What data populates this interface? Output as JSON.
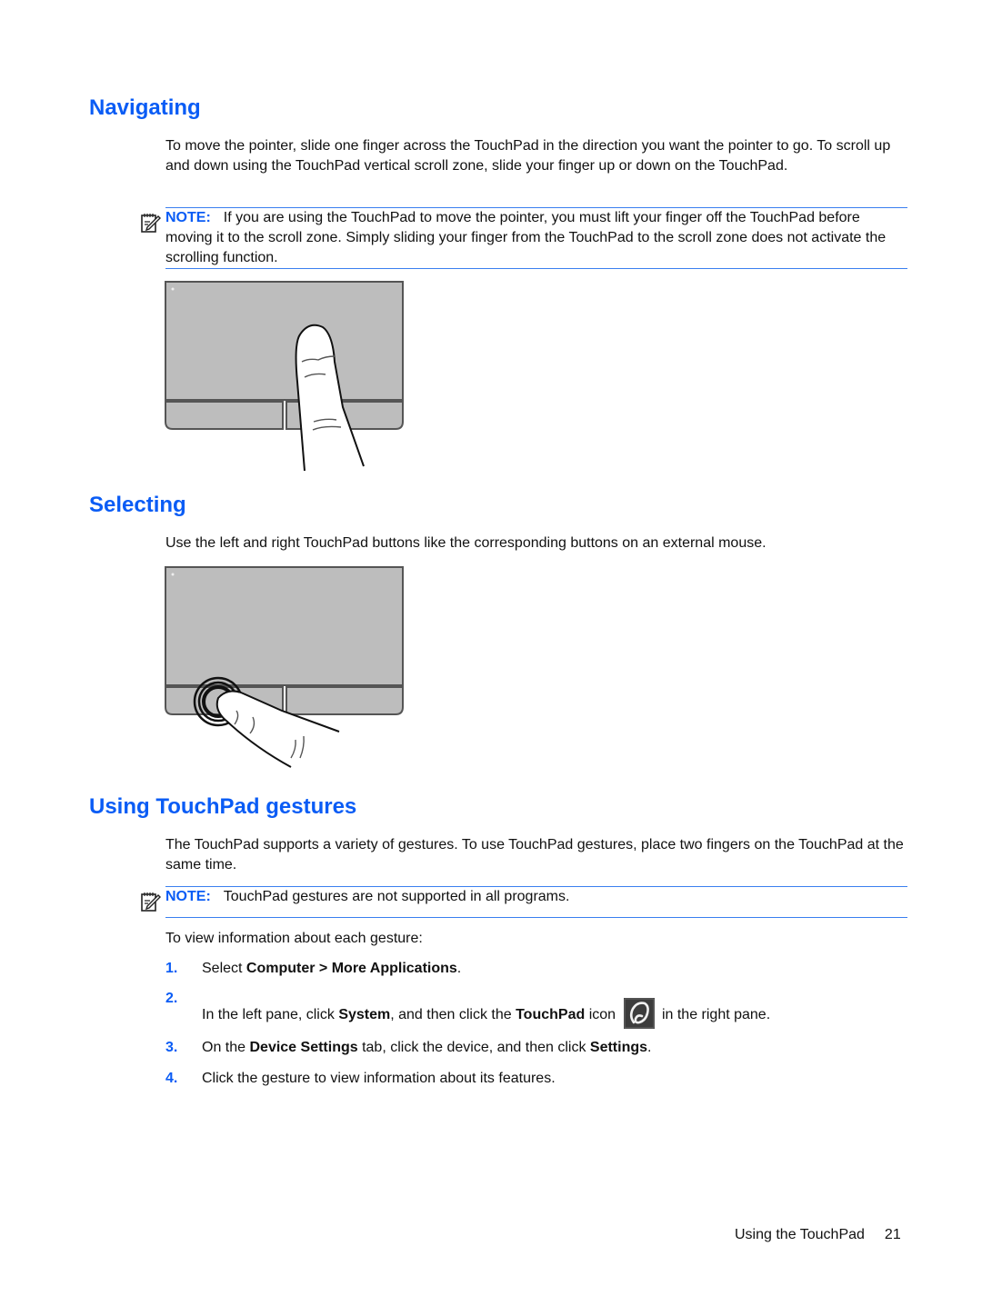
{
  "sections": {
    "navigating": {
      "title": "Navigating",
      "body": "To move the pointer, slide one finger across the TouchPad in the direction you want the pointer to go. To scroll up and down using the TouchPad vertical scroll zone, slide your finger up or down on the TouchPad.",
      "note_label": "NOTE:",
      "note_text": "If you are using the TouchPad to move the pointer, you must lift your finger off the TouchPad before moving it to the scroll zone. Simply sliding your finger from the TouchPad to the scroll zone does not activate the scrolling function.",
      "figure": "touchpad-one-finger-slide-illustration"
    },
    "selecting": {
      "title": "Selecting",
      "body": "Use the left and right TouchPad buttons like the corresponding buttons on an external mouse.",
      "figure": "touchpad-left-button-press-illustration"
    },
    "gestures": {
      "title": "Using TouchPad gestures",
      "body": "The TouchPad supports a variety of gestures. To use TouchPad gestures, place two fingers on the TouchPad at the same time.",
      "note_label": "NOTE:",
      "note_text": "TouchPad gestures are not supported in all programs.",
      "intro": "To view information about each gesture:",
      "steps": [
        {
          "num": "1.",
          "parts": [
            {
              "t": "Select ",
              "b": false
            },
            {
              "t": "Computer > More Applications",
              "b": true
            },
            {
              "t": ".",
              "b": false
            }
          ]
        },
        {
          "num": "2.",
          "parts": [
            {
              "t": "In the left pane, click ",
              "b": false
            },
            {
              "t": "System",
              "b": true
            },
            {
              "t": ", and then click the ",
              "b": false
            },
            {
              "t": "TouchPad",
              "b": true
            },
            {
              "t": " icon",
              "b": false
            }
          ],
          "icon": "touchpad-app-icon",
          "after_icon": "in the right pane."
        },
        {
          "num": "3.",
          "parts": [
            {
              "t": "On the ",
              "b": false
            },
            {
              "t": "Device Settings",
              "b": true
            },
            {
              "t": " tab, click the device, and then click ",
              "b": false
            },
            {
              "t": "Settings",
              "b": true
            },
            {
              "t": ".",
              "b": false
            }
          ]
        },
        {
          "num": "4.",
          "parts": [
            {
              "t": "Click the gesture to view information about its features.",
              "b": false
            }
          ]
        }
      ]
    }
  },
  "footer": {
    "chapter": "Using the TouchPad",
    "page_number": "21"
  },
  "colors": {
    "heading": "#0a5cf5",
    "note_rule": "#3a7ff0",
    "touchpad_fill": "#bdbdbd",
    "touchpad_outline": "#666666"
  }
}
